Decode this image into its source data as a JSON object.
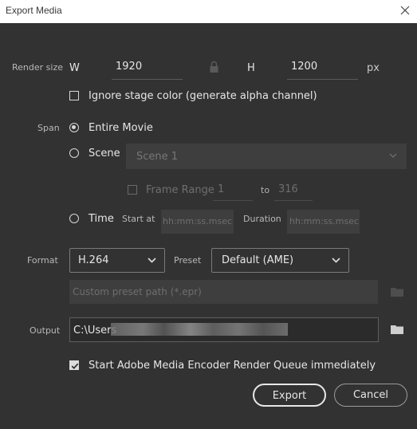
{
  "window": {
    "title": "Export Media"
  },
  "render_size": {
    "label": "Render size",
    "w_label": "W",
    "width": "1920",
    "h_label": "H",
    "height": "1200",
    "unit": "px"
  },
  "ignore_stage_color": {
    "label": "Ignore stage color (generate alpha channel)",
    "checked": false
  },
  "span": {
    "label": "Span",
    "entire_movie": {
      "label": "Entire Movie",
      "selected": true
    },
    "scene": {
      "label": "Scene",
      "dropdown_value": "Scene 1",
      "selected": false
    },
    "frame_range": {
      "label": "Frame Range",
      "from": "1",
      "to_label": "to",
      "to": "316",
      "checked": false
    },
    "time": {
      "label": "Time",
      "start_label": "Start at",
      "start_placeholder": "hh:mm:ss.msec",
      "duration_label": "Duration",
      "duration_placeholder": "hh:mm:ss.msec",
      "selected": false
    }
  },
  "format": {
    "label": "Format",
    "value": "H.264",
    "preset_label": "Preset",
    "preset_value": "Default (AME)",
    "custom_preset_placeholder": "Custom preset path (*.epr)"
  },
  "output": {
    "label": "Output",
    "path": "C:\\Users"
  },
  "start_ame": {
    "label": "Start Adobe Media Encoder Render Queue immediately",
    "checked": true
  },
  "buttons": {
    "export": "Export",
    "cancel": "Cancel"
  },
  "colors": {
    "background": "#323232",
    "titlebar": "#ffffff",
    "field": "#3e3e3e",
    "text": "#e6e6e6"
  },
  "icons": [
    "close-icon",
    "lock-icon",
    "chevron-down-icon",
    "folder-icon",
    "checkmark-icon"
  ]
}
